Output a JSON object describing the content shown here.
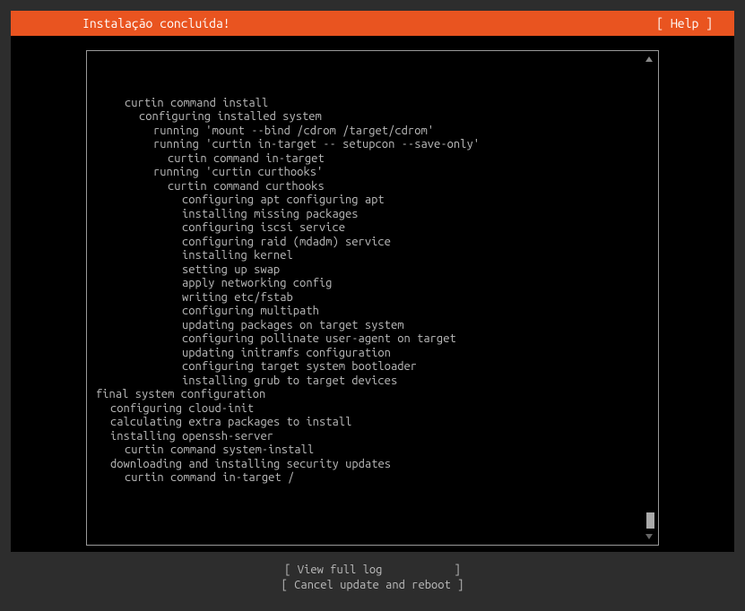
{
  "header": {
    "title": "Instalação concluída!",
    "help": "[ Help ]"
  },
  "log": {
    "lines": [
      {
        "indent": 1,
        "text": "curtin command install"
      },
      {
        "indent": 2,
        "text": "configuring installed system"
      },
      {
        "indent": 3,
        "text": "running 'mount --bind /cdrom /target/cdrom'"
      },
      {
        "indent": 3,
        "text": "running 'curtin in-target -- setupcon --save-only'"
      },
      {
        "indent": 4,
        "text": "curtin command in-target"
      },
      {
        "indent": 3,
        "text": "running 'curtin curthooks'"
      },
      {
        "indent": 4,
        "text": "curtin command curthooks"
      },
      {
        "indent": 5,
        "text": "configuring apt configuring apt"
      },
      {
        "indent": 5,
        "text": "installing missing packages"
      },
      {
        "indent": 5,
        "text": "configuring iscsi service"
      },
      {
        "indent": 5,
        "text": "configuring raid (mdadm) service"
      },
      {
        "indent": 5,
        "text": "installing kernel"
      },
      {
        "indent": 5,
        "text": "setting up swap"
      },
      {
        "indent": 5,
        "text": "apply networking config"
      },
      {
        "indent": 5,
        "text": "writing etc/fstab"
      },
      {
        "indent": 5,
        "text": "configuring multipath"
      },
      {
        "indent": 5,
        "text": "updating packages on target system"
      },
      {
        "indent": 5,
        "text": "configuring pollinate user-agent on target"
      },
      {
        "indent": 5,
        "text": "updating initramfs configuration"
      },
      {
        "indent": 5,
        "text": "configuring target system bootloader"
      },
      {
        "indent": 5,
        "text": "installing grub to target devices"
      },
      {
        "indent": -1,
        "text": "final system configuration"
      },
      {
        "indent": 0,
        "text": "configuring cloud-init"
      },
      {
        "indent": 0,
        "text": "calculating extra packages to install"
      },
      {
        "indent": 0,
        "text": "installing openssh-server"
      },
      {
        "indent": 1,
        "text": "curtin command system-install"
      },
      {
        "indent": 0,
        "text": "downloading and installing security updates"
      },
      {
        "indent": 1,
        "text": "curtin command in-target /"
      }
    ]
  },
  "footer": {
    "view_log": "[ View full log           ]",
    "cancel_reboot": "[ Cancel update and reboot ]"
  }
}
